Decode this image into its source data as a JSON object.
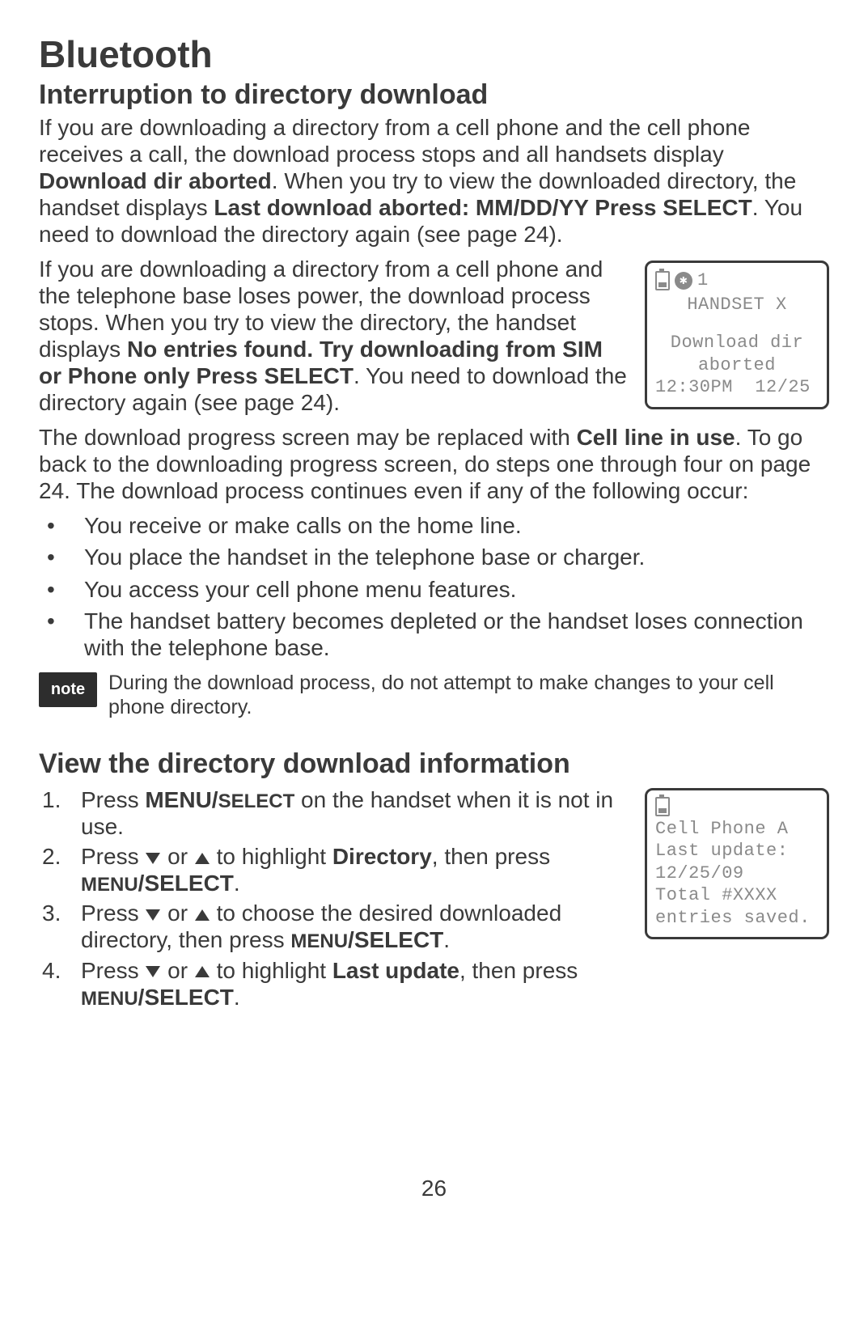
{
  "page": {
    "title": "Bluetooth",
    "number": "26"
  },
  "section1": {
    "heading": "Interruption to directory download",
    "para1_a": "If you are downloading a directory from a cell phone and the cell phone receives a call, the download process stops and all handsets display ",
    "para1_b": "Download dir aborted",
    "para1_c": ". When you try to view the downloaded directory, the handset displays ",
    "para1_d": "Last download aborted: MM/DD/YY Press SELECT",
    "para1_e": ". You need to download the directory again (see page 24).",
    "para2_a": "If you are downloading a directory from a cell phone and the telephone base loses power, the download process stops. When you try to view the directory, the handset displays ",
    "para2_b": "No entries found. Try downloading from SIM or Phone only Press SELECT",
    "para2_c": ". You need to download the directory again (see page 24).",
    "para3_a": "The download progress screen may be replaced with ",
    "para3_b": "Cell line in use",
    "para3_c": ". To go back to the downloading progress screen, do steps one through four on page 24. The download process continues even if any of the following occur:",
    "bullets": [
      "You receive or make calls on the home line.",
      "You place the handset in the telephone base or charger.",
      "You access your cell phone menu features.",
      "The handset battery becomes depleted or the handset loses connection with the telephone base."
    ],
    "note_label": "note",
    "note_text": "During the download process, do not attempt to make changes to your cell phone directory."
  },
  "lcd1": {
    "bt_num": "1",
    "line1": "HANDSET X",
    "line2": "Download dir",
    "line3": "aborted",
    "line4": "12:30PM  12/25"
  },
  "section2": {
    "heading": "View the directory download information",
    "steps": {
      "s1_a": "Press ",
      "s1_b": "MENU/",
      "s1_c": "SELECT",
      "s1_d": " on the handset when it is not in use.",
      "s2_a": "Press ",
      "s2_b": " or ",
      "s2_c": " to highlight ",
      "s2_d": "Directory",
      "s2_e": ", then press ",
      "s2_f": "MENU",
      "s2_g": "/SELECT",
      "s2_h": ".",
      "s3_a": "Press ",
      "s3_b": " or ",
      "s3_c": " to choose the desired downloaded directory, then press ",
      "s3_d": "MENU",
      "s3_e": "/SELECT",
      "s3_f": ".",
      "s4_a": "Press ",
      "s4_b": " or ",
      "s4_c": " to highlight ",
      "s4_d": "Last update",
      "s4_e": ", then press ",
      "s4_f": "MENU",
      "s4_g": "/SELECT",
      "s4_h": "."
    }
  },
  "lcd2": {
    "line1": "Cell Phone A",
    "line2": "Last update:",
    "line3": "12/25/09",
    "line4": "Total #XXXX",
    "line5": "entries saved."
  }
}
